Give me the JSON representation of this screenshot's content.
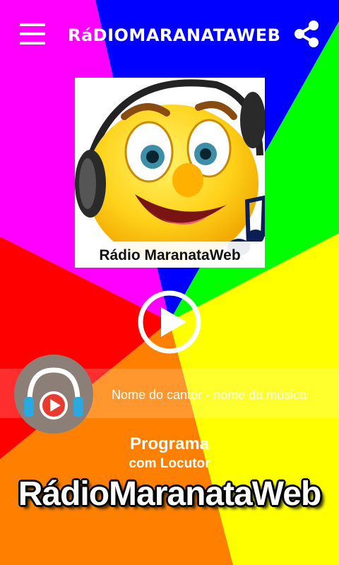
{
  "app": {
    "title": "RáDIOMARANATAWEB"
  },
  "toolbar": {
    "menu_icon": "hamburger-menu-icon",
    "share_icon": "share-icon"
  },
  "cover": {
    "caption": "Rádio MaranataWeb",
    "image": "emoji-with-headphones-and-music-note"
  },
  "player": {
    "play_icon": "play-icon",
    "disc_icon": "headphones-play-icon",
    "now_playing": "Nome do cantor - nome da música"
  },
  "program": {
    "title": "Programa",
    "subtitle": "com Locutor",
    "brand": "RádioMaranataWeb"
  },
  "colors": {
    "magenta": "#ff00ff",
    "blue": "#0000ff",
    "green": "#00ff00",
    "yellow": "#ffff00",
    "orange": "#ff7f00",
    "red": "#ff0000",
    "disc": "#8c7f77",
    "accent_red": "#e63b2e",
    "accent_blue": "#2aa9e0"
  }
}
